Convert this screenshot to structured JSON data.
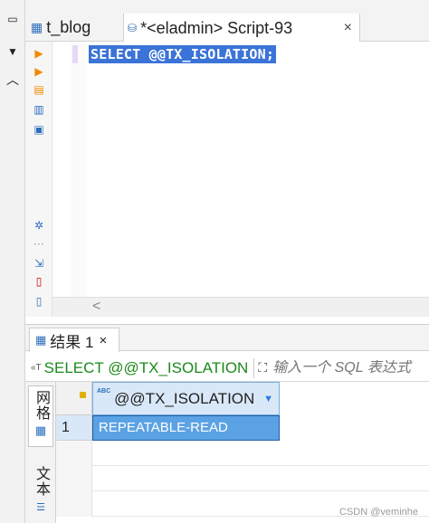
{
  "editor": {
    "tabs": [
      {
        "label": "t_blog"
      },
      {
        "label": "*<eladmin> Script-93",
        "close": "×"
      }
    ],
    "code": "SELECT @@TX_ISOLATION;",
    "scroll_left": "<"
  },
  "results": {
    "tab_label": "结果 1",
    "tab_close": "×",
    "query": "SELECT @@TX_ISOLATION",
    "filter_placeholder": "输入一个 SQL 表达式",
    "side_tabs": {
      "grid": "网格",
      "text": "文本"
    },
    "column": {
      "badge": "ABC",
      "name": "@@TX_ISOLATION"
    },
    "rows": [
      {
        "num": "1",
        "value": "REPEATABLE-READ"
      }
    ]
  },
  "watermark": "CSDN @veminhe",
  "colors": {
    "selection": "#3b73d8",
    "cell_selected": "#5ba2e4",
    "query_green": "#1b8a1b"
  }
}
